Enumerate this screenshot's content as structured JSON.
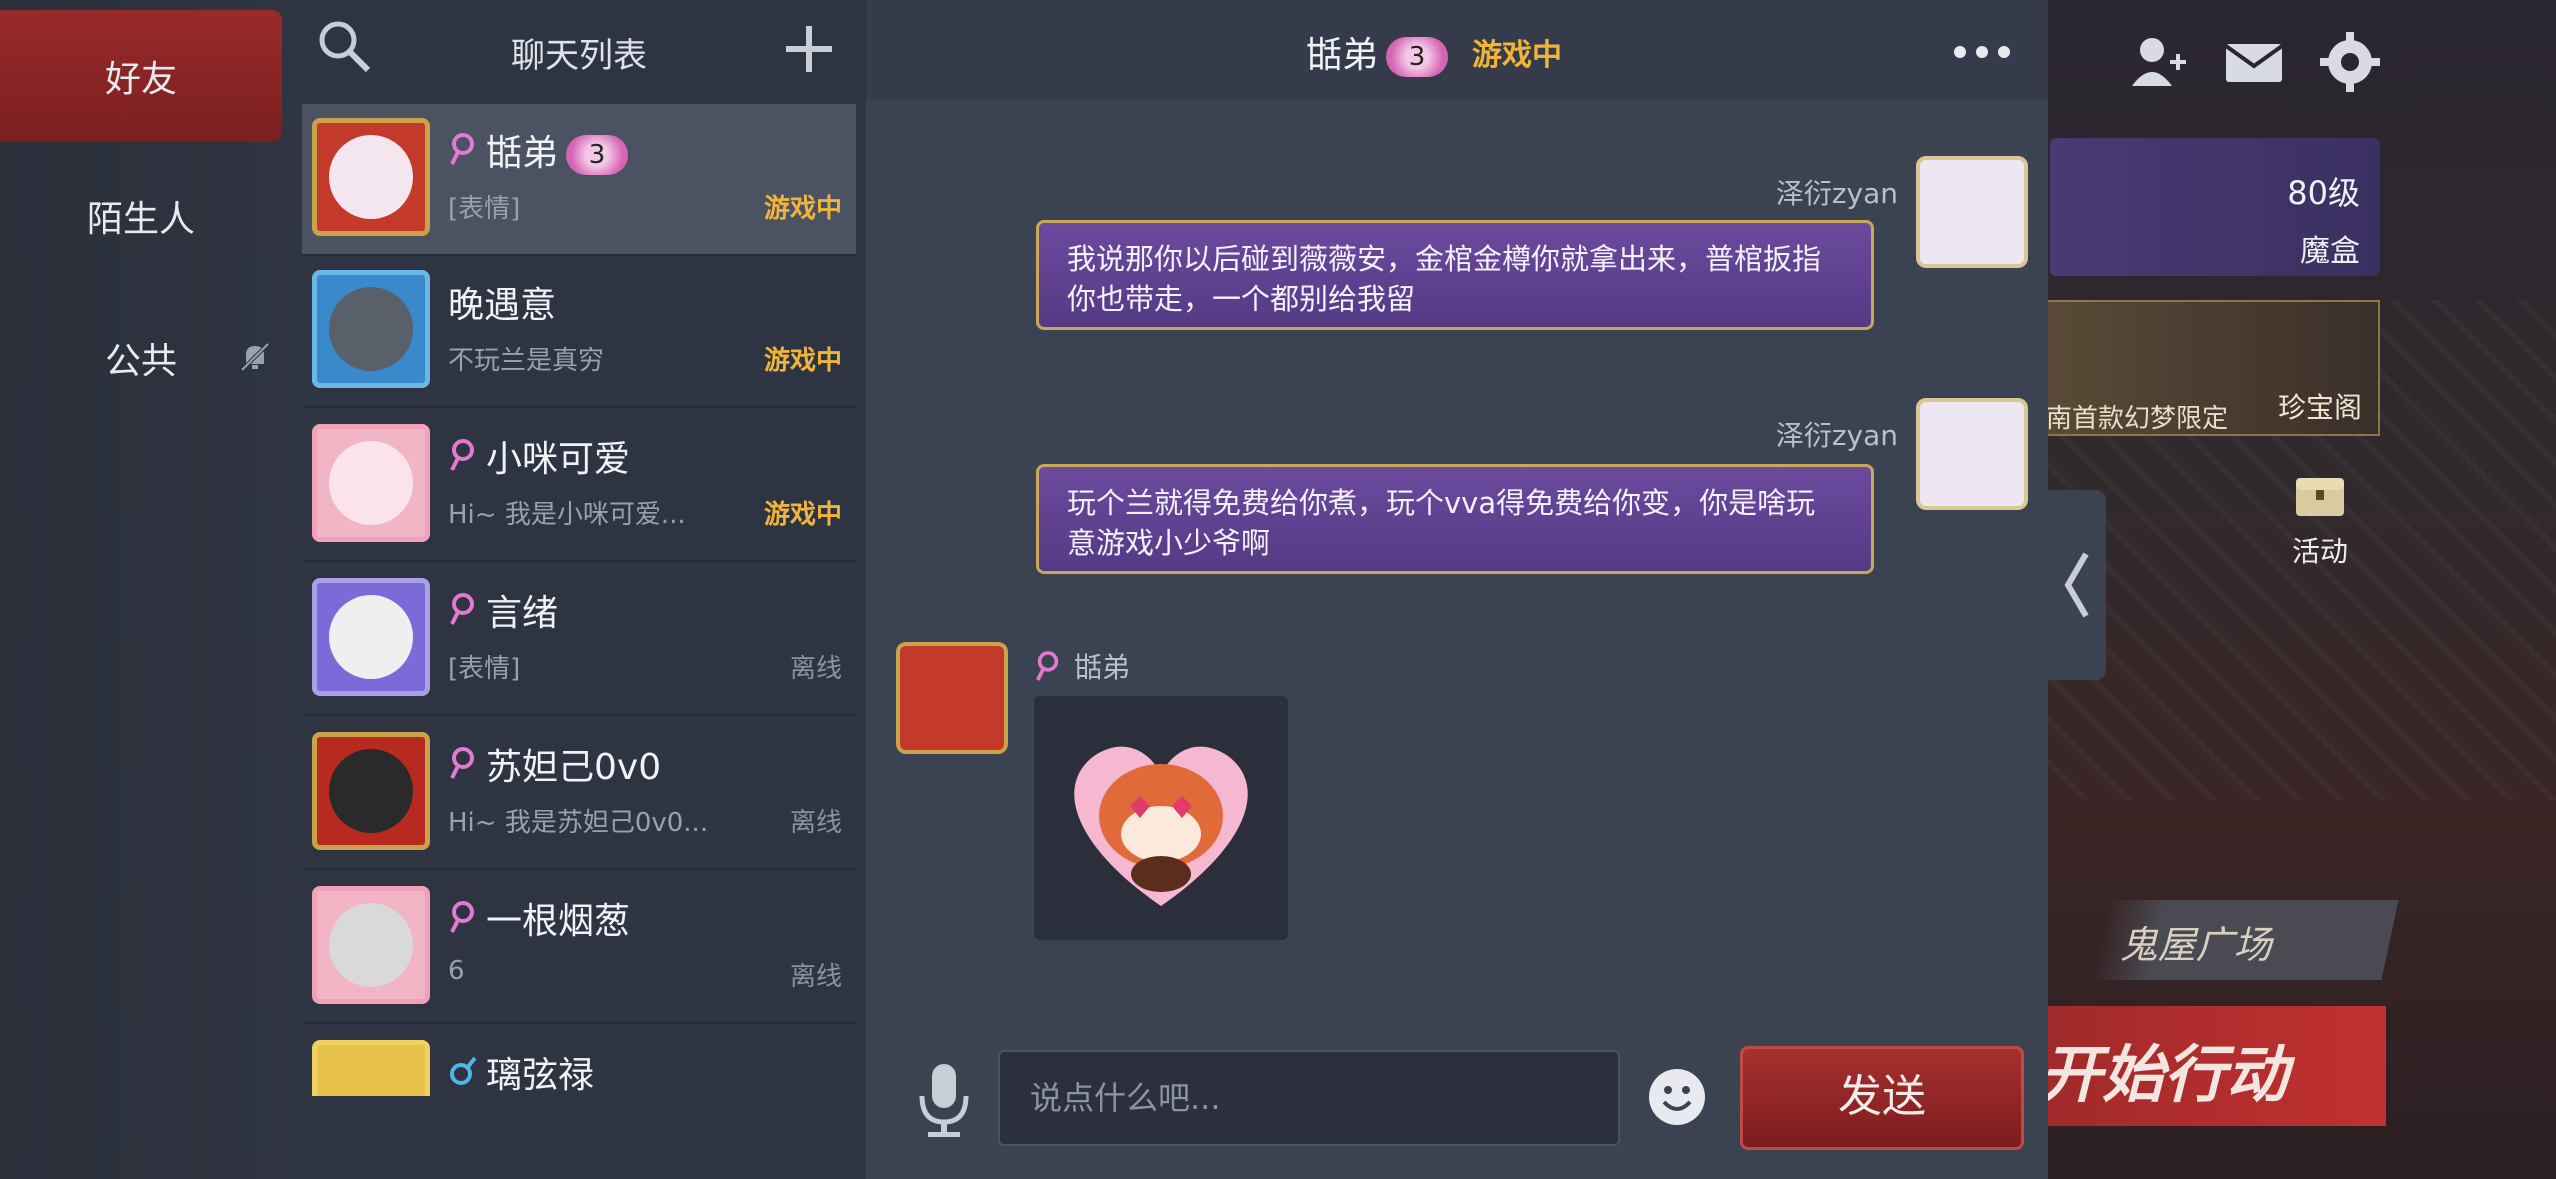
{
  "tabs": [
    {
      "label": "好友",
      "active": true
    },
    {
      "label": "陌生人",
      "active": false
    },
    {
      "label": "公共",
      "active": false,
      "icon": "bell-muted-icon"
    }
  ],
  "chat_list": {
    "title": "聊天列表",
    "rows": [
      {
        "name": "甛弟",
        "badge": "3",
        "preview": "[表情]",
        "status": "游戏中",
        "gender": "female",
        "active": true
      },
      {
        "name": "晚遇意",
        "preview": "不玩兰是真穷",
        "status": "游戏中",
        "gender": "none"
      },
      {
        "name": "小咪可爱",
        "preview": "Hi~ 我是小咪可爱...",
        "status": "游戏中",
        "gender": "female"
      },
      {
        "name": "言绪",
        "preview": "[表情]",
        "status": "离线",
        "gender": "female"
      },
      {
        "name": "苏妲己0v0",
        "preview": "Hi~ 我是苏妲己0v0...",
        "status": "离线",
        "gender": "female"
      },
      {
        "name": "一根烟葱",
        "preview": "6",
        "status": "离线",
        "gender": "female"
      },
      {
        "name": "璃弦禄",
        "preview": "",
        "status": "",
        "gender": "male"
      }
    ]
  },
  "chat": {
    "peer_name": "甛弟",
    "peer_badge": "3",
    "peer_status": "游戏中",
    "messages": [
      {
        "sender": "泽衍zyan",
        "text": "我说那你以后碰到薇薇安，金棺金樽你就拿出来，普棺扳指你也带走，一个都别给我留"
      },
      {
        "sender": "泽衍zyan",
        "text": "玩个兰就得免费给你煮，玩个vva得免费给你变，你是啥玩意游戏小少爷啊"
      },
      {
        "sender": "甛弟",
        "text": "",
        "type": "sticker",
        "sticker": "red-panda-heart-eyes"
      }
    ],
    "input_placeholder": "说点什么吧...",
    "send_label": "发送"
  },
  "background": {
    "level": "80级",
    "magic_box": "魔盒",
    "shop_label": "珍宝阁",
    "shop_banner": "南首款幻梦限定",
    "activity_label": "活动",
    "plaza_label": "鬼屋广场",
    "start_label": "开始行动"
  },
  "colors": {
    "accent_red": "#9a2a2a",
    "status_ingame": "#f1b43a",
    "bubble_purple": "#5f4290",
    "badge_pink": "#d566b5"
  }
}
